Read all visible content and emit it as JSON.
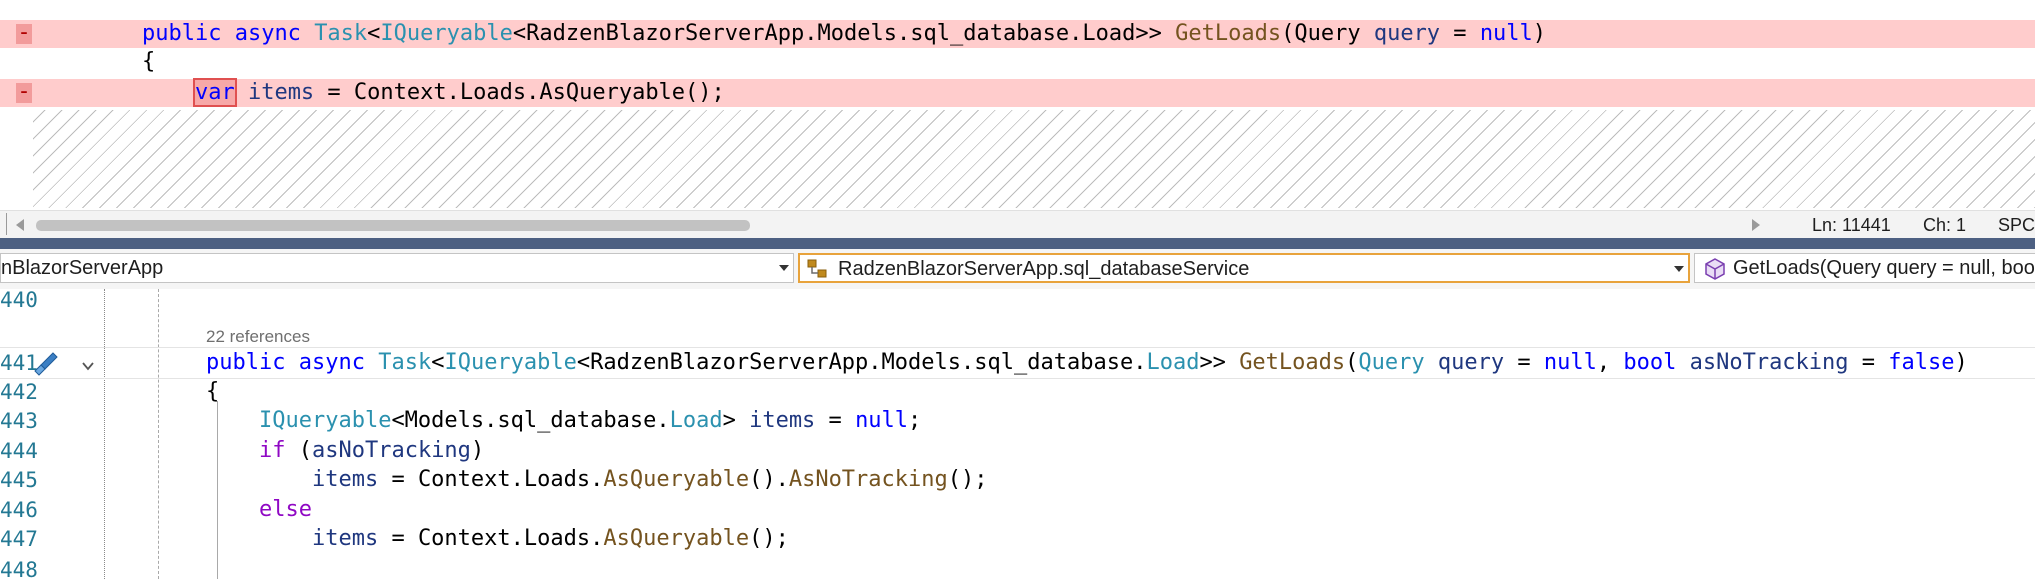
{
  "diff_pane": {
    "lines": [
      {
        "type": "removed",
        "marker": "-",
        "tokens": [
          {
            "t": "        "
          },
          {
            "t": "public",
            "c": "kw"
          },
          {
            "t": " "
          },
          {
            "t": "async",
            "c": "kw"
          },
          {
            "t": " "
          },
          {
            "t": "Task",
            "c": "ty"
          },
          {
            "t": "<"
          },
          {
            "t": "IQueryable",
            "c": "ty"
          },
          {
            "t": "<RadzenBlazorServerApp.Models.sql_database.Load>> "
          },
          {
            "t": "GetLoads",
            "c": "me"
          },
          {
            "t": "(Query "
          },
          {
            "t": "query",
            "c": "id"
          },
          {
            "t": " = "
          },
          {
            "t": "null",
            "c": "kw"
          },
          {
            "t": ")"
          }
        ]
      },
      {
        "type": "context",
        "marker": "",
        "tokens": [
          {
            "t": "        {"
          }
        ]
      },
      {
        "type": "removed",
        "marker": "-",
        "tokens": [
          {
            "t": "            "
          },
          {
            "t": "var",
            "c": "kw",
            "box": true
          },
          {
            "t": " "
          },
          {
            "t": "items",
            "c": "id"
          },
          {
            "t": " = Context.Loads.AsQueryable();"
          }
        ]
      }
    ]
  },
  "status_bar": {
    "line": "Ln: 11441",
    "col": "Ch: 1",
    "whitespace": "SPC"
  },
  "nav_bar": {
    "project": "nBlazorServerApp",
    "type_scope": "RadzenBlazorServerApp.sql_databaseService",
    "member": "GetLoads(Query query = null, boo"
  },
  "editor": {
    "codelens": "22 references",
    "lines": [
      {
        "num": "440",
        "tokens": []
      },
      {
        "num": "441",
        "current": true,
        "tokens": [
          {
            "t": "public",
            "c": "kw"
          },
          {
            "t": " "
          },
          {
            "t": "async",
            "c": "kw"
          },
          {
            "t": " "
          },
          {
            "t": "Task",
            "c": "ty"
          },
          {
            "t": "<"
          },
          {
            "t": "IQueryable",
            "c": "ty"
          },
          {
            "t": "<RadzenBlazorServerApp.Models.sql_database."
          },
          {
            "t": "Load",
            "c": "ty"
          },
          {
            "t": ">> "
          },
          {
            "t": "GetLoads",
            "c": "me"
          },
          {
            "t": "("
          },
          {
            "t": "Query",
            "c": "ty"
          },
          {
            "t": " "
          },
          {
            "t": "query",
            "c": "id"
          },
          {
            "t": " = "
          },
          {
            "t": "null",
            "c": "kw"
          },
          {
            "t": ", "
          },
          {
            "t": "bool",
            "c": "kw"
          },
          {
            "t": " "
          },
          {
            "t": "asNoTracking",
            "c": "id"
          },
          {
            "t": " = "
          },
          {
            "t": "false",
            "c": "kw"
          },
          {
            "t": ")"
          }
        ]
      },
      {
        "num": "442",
        "tokens": [
          {
            "t": "{"
          }
        ]
      },
      {
        "num": "443",
        "tokens": [
          {
            "t": "    "
          },
          {
            "t": "IQueryable",
            "c": "ty"
          },
          {
            "t": "<Models.sql_database."
          },
          {
            "t": "Load",
            "c": "ty"
          },
          {
            "t": "> "
          },
          {
            "t": "items",
            "c": "id"
          },
          {
            "t": " = "
          },
          {
            "t": "null",
            "c": "kw"
          },
          {
            "t": ";"
          }
        ]
      },
      {
        "num": "444",
        "tokens": [
          {
            "t": "    "
          },
          {
            "t": "if",
            "c": "ctl"
          },
          {
            "t": " ("
          },
          {
            "t": "asNoTracking",
            "c": "id"
          },
          {
            "t": ")"
          }
        ]
      },
      {
        "num": "445",
        "tokens": [
          {
            "t": "        "
          },
          {
            "t": "items",
            "c": "id"
          },
          {
            "t": " = Context.Loads."
          },
          {
            "t": "AsQueryable",
            "c": "me"
          },
          {
            "t": "()."
          },
          {
            "t": "AsNoTracking",
            "c": "me"
          },
          {
            "t": "();"
          }
        ]
      },
      {
        "num": "446",
        "tokens": [
          {
            "t": "    "
          },
          {
            "t": "else",
            "c": "ctl"
          }
        ]
      },
      {
        "num": "447",
        "tokens": [
          {
            "t": "        "
          },
          {
            "t": "items",
            "c": "id"
          },
          {
            "t": " = Context.Loads."
          },
          {
            "t": "AsQueryable",
            "c": "me"
          },
          {
            "t": "();"
          }
        ]
      },
      {
        "num": "448",
        "tokens": []
      }
    ]
  },
  "colors": {
    "removed_bg": "#ffcccc",
    "keyword": "#0000ff",
    "type": "#2b91af",
    "identifier": "#1f377f",
    "method": "#74531f",
    "control": "#8f08c4",
    "splitter": "#4d6082",
    "line_number": "#237893"
  },
  "icons": {
    "nav_type": "class-hierarchy-icon",
    "nav_member": "method-cube-icon",
    "gutter": "brush-icon",
    "fold": "chevron-down-icon"
  }
}
